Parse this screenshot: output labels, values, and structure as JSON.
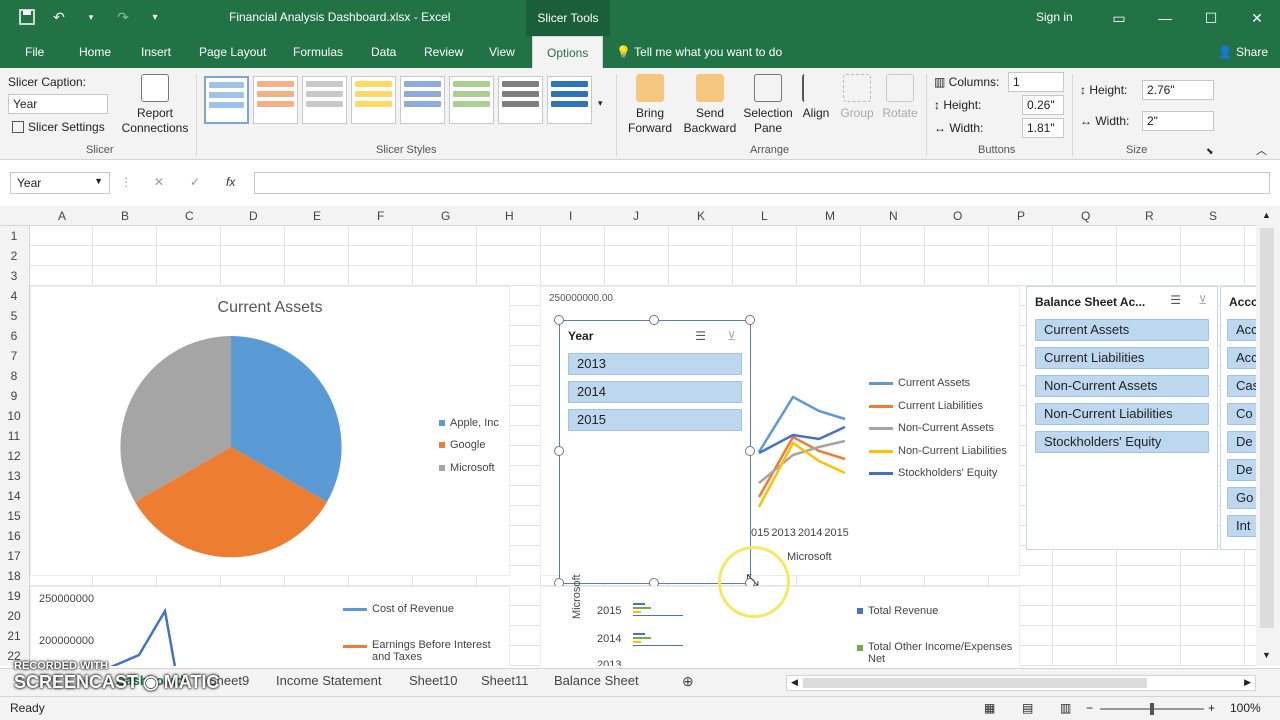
{
  "window": {
    "title": "Financial Analysis Dashboard.xlsx - Excel",
    "context_tab": "Slicer Tools",
    "sign_in": "Sign in"
  },
  "ribbon_tabs": [
    "File",
    "Home",
    "Insert",
    "Page Layout",
    "Formulas",
    "Data",
    "Review",
    "View",
    "Options"
  ],
  "tell_me": "Tell me what you want to do",
  "share": "Share",
  "slicer_group": {
    "caption_label": "Slicer Caption:",
    "caption_value": "Year",
    "settings": "Slicer Settings",
    "report_connections": "Report Connections",
    "group_label": "Slicer"
  },
  "styles_group_label": "Slicer Styles",
  "arrange": {
    "bring_forward": "Bring Forward",
    "send_backward": "Send Backward",
    "selection_pane": "Selection Pane",
    "align": "Align",
    "group": "Group",
    "rotate": "Rotate",
    "group_label": "Arrange"
  },
  "buttons_group": {
    "columns_label": "Columns:",
    "columns_value": "1",
    "height_label": "Height:",
    "height_value": "0.26\"",
    "width_label": "Width:",
    "width_value": "1.81\"",
    "group_label": "Buttons"
  },
  "size_group": {
    "height_label": "Height:",
    "height_value": "2.76\"",
    "width_label": "Width:",
    "width_value": "2\"",
    "group_label": "Size"
  },
  "namebox": "Year",
  "columns": [
    "A",
    "B",
    "C",
    "D",
    "E",
    "F",
    "G",
    "H",
    "I",
    "J",
    "K",
    "L",
    "M",
    "N",
    "O",
    "P",
    "Q",
    "R",
    "S"
  ],
  "rows": [
    "1",
    "2",
    "3",
    "4",
    "5",
    "6",
    "7",
    "8",
    "9",
    "10",
    "11",
    "12",
    "13",
    "14",
    "15",
    "16",
    "17",
    "18",
    "19",
    "20",
    "21",
    "22"
  ],
  "pie_chart": {
    "title": "Current Assets",
    "legend": [
      "Apple, Inc",
      "Google",
      "Microsoft"
    ],
    "colors": [
      "#5b9bd5",
      "#ed7d31",
      "#a5a5a5"
    ]
  },
  "line_chart": {
    "y_top_label": "250000000.00",
    "axis_years": [
      "015",
      "2013",
      "2014",
      "2015"
    ],
    "axis_group": "Microsoft",
    "legend": [
      "Current Assets",
      "Current Liabilities",
      "Non-Current Assets",
      "Non-Current Liabilities",
      "Stockholders' Equity"
    ],
    "colors": [
      "#5b9bd5",
      "#ed7d31",
      "#a5a5a5",
      "#ffc000",
      "#4472c4"
    ]
  },
  "year_slicer": {
    "title": "Year",
    "items": [
      "2013",
      "2014",
      "2015"
    ]
  },
  "balance_slicer": {
    "title": "Balance Sheet Ac...",
    "items": [
      "Current Assets",
      "Current Liabilities",
      "Non-Current Assets",
      "Non-Current Liabilities",
      "Stockholders' Equity"
    ]
  },
  "acc_slicer": {
    "title": "Acco",
    "items": [
      "Acc",
      "Acc",
      "Cas",
      "Co",
      "De",
      "De",
      "Go",
      "Int"
    ]
  },
  "bottom_left_chart": {
    "y_labels": [
      "250000000",
      "200000000"
    ],
    "legend": [
      "Cost of Revenue",
      "Earnings Before Interest and Taxes"
    ]
  },
  "bottom_mid_chart": {
    "years": [
      "2015",
      "2014",
      "2013"
    ],
    "axis_group": "Microsoft"
  },
  "bottom_right_legend": [
    "Total Revenue",
    "Total Other Income/Expenses Net"
  ],
  "sheet_tabs": [
    "Dashboard",
    "Sheet9",
    "Income Statement",
    "Sheet10",
    "Sheet11",
    "Balance Sheet"
  ],
  "status": "Ready",
  "zoom": "100%",
  "watermark": [
    "RECORDED WITH",
    "SCREENCAST",
    "MATIC"
  ]
}
